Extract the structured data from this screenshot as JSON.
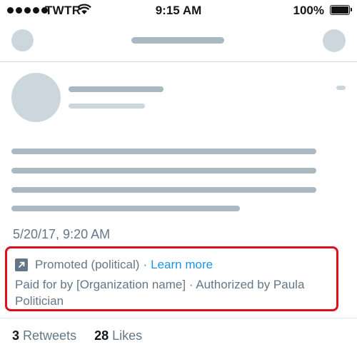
{
  "status_bar": {
    "carrier": "TWTR",
    "time": "9:15 AM",
    "battery": "100%",
    "signal_icon": "signal-dots-icon",
    "wifi_icon": "wifi-icon",
    "battery_icon": "battery-icon",
    "battery_level": 1.0
  },
  "tweet": {
    "timestamp": "5/20/17, 9:20 AM",
    "promoted": {
      "icon": "promoted-arrow-icon",
      "label": "Promoted (political)",
      "separator": "·",
      "learn_more": "Learn more",
      "paid_for": "Paid for by [Organization name] · Authorized by Paula Politician"
    },
    "stats": {
      "retweets_count": "3",
      "retweets_label": "Retweets",
      "likes_count": "28",
      "likes_label": "Likes"
    }
  },
  "colors": {
    "accent": "#1b95e0",
    "highlight_border": "#e0101a",
    "muted_text": "#657786",
    "placeholder_dark": "#aab8c2",
    "placeholder_light": "#ccd6dd"
  }
}
